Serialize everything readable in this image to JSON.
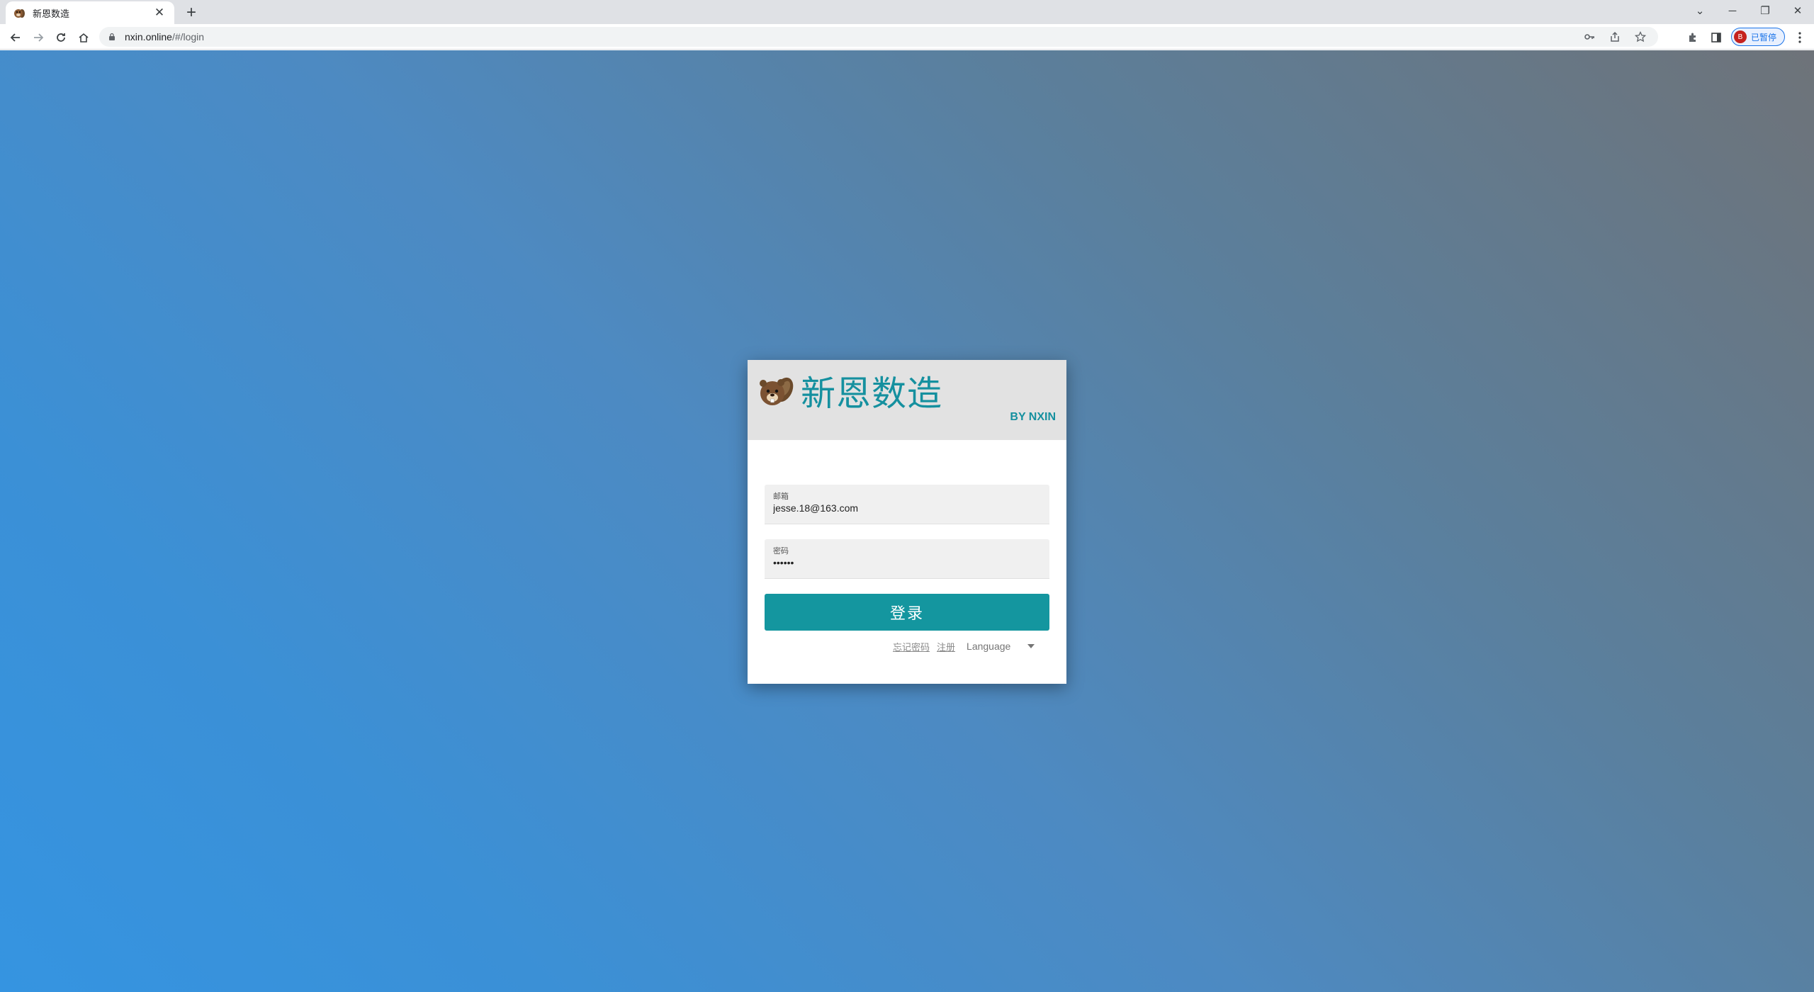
{
  "browser": {
    "tab_title": "新恩数造",
    "tab_close": "✕",
    "new_tab": "+",
    "url_host": "nxin.online",
    "url_path": "/#/login",
    "profile_initial": "B",
    "profile_label": "已暂停",
    "window_controls": {
      "tab_search": "⌄",
      "minimize": "─",
      "restore": "❐",
      "close": "✕"
    }
  },
  "login_card": {
    "brand_name": "新恩数造",
    "byline": "BY NXIN",
    "email": {
      "label": "邮箱",
      "value": "jesse.18@163.com"
    },
    "password": {
      "label": "密码",
      "value": "••••••"
    },
    "submit_label": "登录",
    "forgot_password": "忘记密码",
    "register": "注册",
    "language": "Language"
  },
  "colors": {
    "accent": "#14969f",
    "brand_text": "#15909f",
    "background_top_right": "#6e7379",
    "background_bottom_left": "#3594e1"
  }
}
